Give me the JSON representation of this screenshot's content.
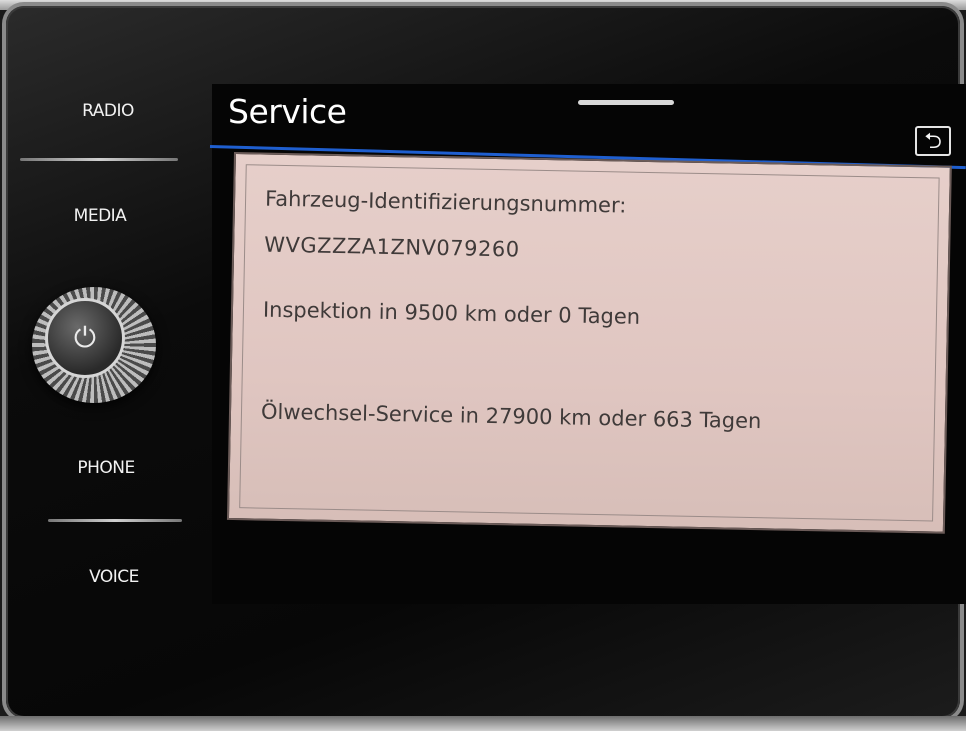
{
  "sidebar": {
    "items": [
      {
        "label": "RADIO"
      },
      {
        "label": "MEDIA"
      },
      {
        "label": "PHONE"
      },
      {
        "label": "VOICE"
      }
    ]
  },
  "knob": {
    "icon": "power-icon",
    "glyph": "⏻"
  },
  "header": {
    "title": "Service",
    "back_icon": "back-icon",
    "back_glyph": "⮌"
  },
  "service": {
    "vin_label": "Fahrzeug-Identifizierungsnummer:",
    "vin_value": "WVGZZZA1ZNV079260",
    "inspection": "Inspektion in 9500 km oder 0 Tagen",
    "oil_service": "Ölwechsel-Service in 27900 km oder 663 Tagen"
  },
  "colors": {
    "accent_line": "#1f5fd0",
    "panel_bg": "#e0c6c1"
  }
}
